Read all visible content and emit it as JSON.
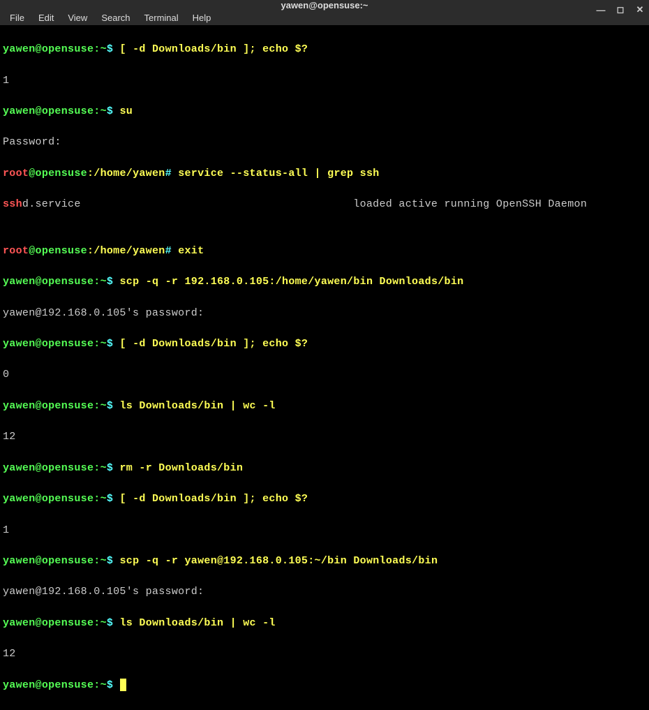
{
  "window": {
    "title": "yawen@opensuse:~"
  },
  "menu": {
    "file": "File",
    "edit": "Edit",
    "view": "View",
    "search": "Search",
    "terminal": "Terminal",
    "help": "Help"
  },
  "prompt": {
    "user": "yawen",
    "at": "@",
    "host": "opensuse",
    "colon": ":",
    "path": "~",
    "dollar": "$"
  },
  "root_prompt": {
    "user": "root",
    "at": "@",
    "host": "opensuse",
    "colon": ":",
    "path": "/home/yawen",
    "dollar": "#"
  },
  "lines": {
    "cmd1": " [ -d Downloads/bin ]; echo $?",
    "out1": "1",
    "cmd2": " su",
    "out2": "Password:",
    "cmd3": " service --status-all | grep ssh",
    "ssh_part1": "ssh",
    "ssh_part2": "d.service                                          loaded active running OpenSSH Daemon",
    "blank": "",
    "cmd4": " exit",
    "cmd5": " scp -q -r 192.168.0.105:/home/yawen/bin Downloads/bin",
    "out5": "yawen@192.168.0.105's password:",
    "cmd6": " [ -d Downloads/bin ]; echo $?",
    "out6": "0",
    "cmd7": " ls Downloads/bin | wc -l",
    "out7": "12",
    "cmd8": " rm -r Downloads/bin",
    "cmd9": " [ -d Downloads/bin ]; echo $?",
    "out9": "1",
    "cmd10": " scp -q -r yawen@192.168.0.105:~/bin Downloads/bin",
    "out10": "yawen@192.168.0.105's password:",
    "cmd11": " ls Downloads/bin | wc -l",
    "out11": "12",
    "cmd12": " "
  }
}
